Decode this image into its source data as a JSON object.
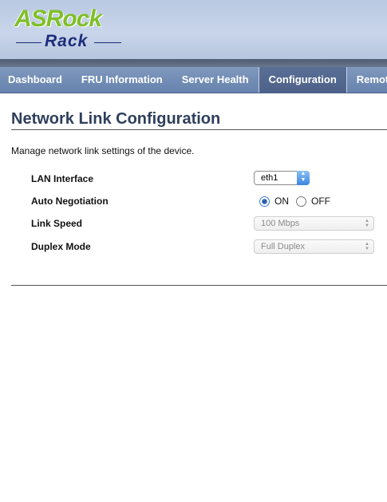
{
  "brand": {
    "top": "ASRock",
    "bottom": "Rack"
  },
  "nav": {
    "items": [
      {
        "label": "Dashboard"
      },
      {
        "label": "FRU Information"
      },
      {
        "label": "Server Health"
      },
      {
        "label": "Configuration"
      },
      {
        "label": "Remot"
      }
    ],
    "active": "Configuration"
  },
  "page": {
    "title": "Network Link Configuration",
    "description": "Manage network link settings of the device."
  },
  "form": {
    "lan_interface": {
      "label": "LAN Interface",
      "value": "eth1"
    },
    "auto_negotiation": {
      "label": "Auto Negotiation",
      "on_label": "ON",
      "off_label": "OFF",
      "selected": "ON"
    },
    "link_speed": {
      "label": "Link Speed",
      "value": "100 Mbps"
    },
    "duplex_mode": {
      "label": "Duplex Mode",
      "value": "Full Duplex"
    }
  }
}
